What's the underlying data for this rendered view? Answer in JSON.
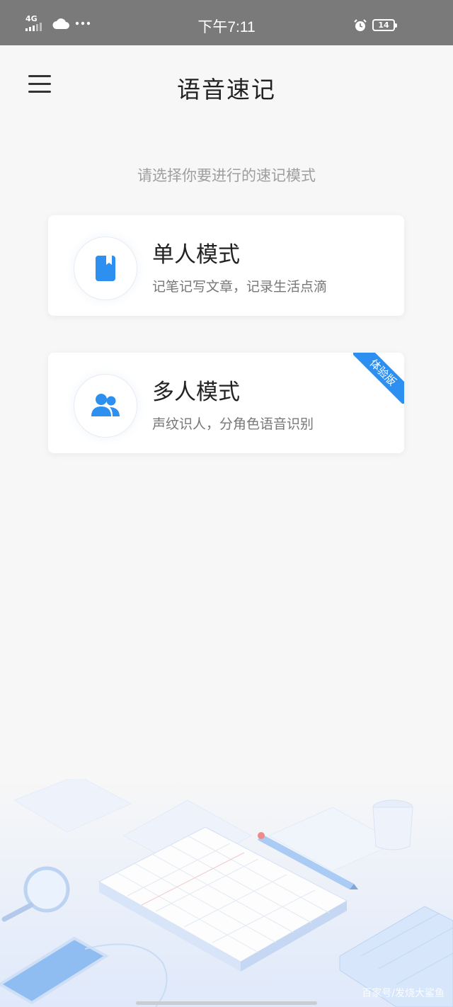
{
  "status_bar": {
    "network": "4G",
    "time": "下午7:11",
    "battery": "14"
  },
  "header": {
    "title": "语音速记"
  },
  "subtitle": "请选择你要进行的速记模式",
  "modes": [
    {
      "title": "单人模式",
      "description": "记笔记写文章，记录生活点滴",
      "icon": "book-icon"
    },
    {
      "title": "多人模式",
      "description": "声纹识人，分角色语音识别",
      "icon": "users-icon",
      "badge": "体验版"
    }
  ],
  "watermark": "百家号/发烧大鲨鱼",
  "colors": {
    "accent": "#2d8ff0",
    "status_bar": "#7a7a7a",
    "background": "#f7f7f7"
  }
}
